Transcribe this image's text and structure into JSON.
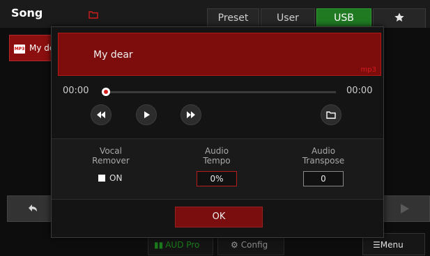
{
  "header": {
    "title": "Song",
    "tabs": [
      {
        "label": "Preset",
        "active": false
      },
      {
        "label": "User",
        "active": false
      },
      {
        "label": "USB",
        "active": true
      },
      {
        "label": "",
        "icon": "star-icon",
        "active": false
      }
    ]
  },
  "background_list": {
    "item_label": "My dear",
    "item_format": "MP3"
  },
  "dialog": {
    "song": {
      "name": "My dear",
      "format": "mp3"
    },
    "player": {
      "current_time": "00:00",
      "total_time": "00:00",
      "progress": 0
    },
    "params": {
      "vocal_remover": {
        "label_line1": "Vocal",
        "label_line2": "Remover",
        "value": "ON",
        "checked": true
      },
      "audio_tempo": {
        "label_line1": "Audio",
        "label_line2": "Tempo",
        "value": "0%"
      },
      "audio_transpose": {
        "label_line1": "Audio",
        "label_line2": "Transpose",
        "value": "0"
      }
    },
    "ok_label": "OK"
  },
  "bottom_bar": {
    "aud_label": "AUD Pro",
    "config_label": "Config",
    "menu_label": "Menu"
  },
  "colors": {
    "accent_red": "#7d0d0d",
    "tab_active_green": "#1f7a22",
    "background": "#0d0d0d"
  }
}
